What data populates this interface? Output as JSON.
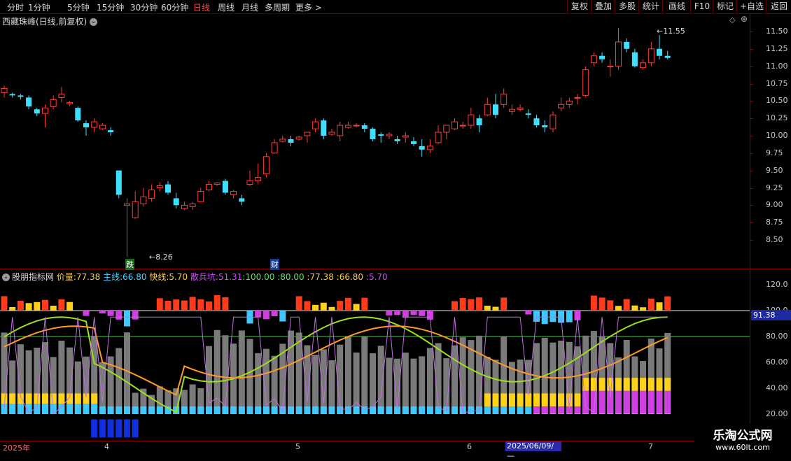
{
  "toolbar": {
    "periods": [
      "分时",
      "1分钟",
      "5分钟",
      "15分钟",
      "30分钟",
      "60分钟",
      "日线",
      "周线",
      "月线",
      "多周期",
      "更多"
    ],
    "active_period": "日线",
    "right_buttons": [
      "复权",
      "叠加",
      "多股",
      "统计",
      "画线",
      "F10",
      "标记",
      "+自选",
      "返回"
    ]
  },
  "main_chart": {
    "title": "西藏珠峰(日线,前复权)",
    "high_label": "11.55",
    "low_label": "8.26",
    "price_ticks": [
      "11.50",
      "11.25",
      "11.00",
      "10.75",
      "10.50",
      "10.25",
      "10.00",
      "9.75",
      "9.50",
      "9.25",
      "9.00",
      "8.75",
      "8.50"
    ],
    "markers": [
      {
        "text": "跌",
        "color": "#1a6b1a"
      },
      {
        "text": "财",
        "color": "#1a3a8a"
      }
    ]
  },
  "indicator": {
    "name": "股朋指标网",
    "items": [
      {
        "label": "价量:",
        "value": "77.38",
        "color": "#ffcc44"
      },
      {
        "label": "主线:",
        "value": "66.80",
        "color": "#49d4ff"
      },
      {
        "label": "快线:",
        "value": "5.70",
        "color": "#ffcc44"
      },
      {
        "label": "散兵坑:",
        "value": "51.31",
        "color": "#d04cff"
      },
      {
        "label": ":",
        "value": "100.00",
        "color": "#66e066"
      },
      {
        "label": ":",
        "value": "80.00",
        "color": "#66e066"
      },
      {
        "label": ":",
        "value": "77.38",
        "color": "#ffcc44"
      },
      {
        "label": ":",
        "value": "66.80",
        "color": "#ffcc44"
      },
      {
        "label": ":",
        "value": "5.70",
        "color": "#d04cff"
      }
    ],
    "ticks": [
      "120.0",
      "100.0",
      "80.00",
      "60.00",
      "40.00",
      "20.00"
    ],
    "current_value": "91.38"
  },
  "dates": {
    "labels": [
      "2025年",
      "4",
      "5",
      "6",
      "7"
    ],
    "highlight": "2025/06/09/—"
  },
  "watermark": {
    "line1": "乐淘公式网",
    "line2": "www.60lt.com"
  },
  "colors": {
    "up": "#ff3b3b",
    "down": "#3fe0ff",
    "grid": "#8a0000",
    "bg": "#000000"
  },
  "chart_data": {
    "type": "candlestick",
    "price_axis": [
      8.5,
      11.5
    ],
    "candles": [
      [
        10.62,
        10.72,
        10.55,
        10.68
      ],
      [
        10.6,
        10.62,
        10.55,
        10.58
      ],
      [
        10.58,
        10.6,
        10.52,
        10.56
      ],
      [
        10.55,
        10.58,
        10.38,
        10.42
      ],
      [
        10.38,
        10.4,
        10.28,
        10.32
      ],
      [
        10.32,
        10.45,
        10.12,
        10.4
      ],
      [
        10.42,
        10.58,
        10.38,
        10.52
      ],
      [
        10.55,
        10.7,
        10.48,
        10.6
      ],
      [
        10.46,
        10.5,
        10.42,
        10.48
      ],
      [
        10.4,
        10.42,
        10.2,
        10.22
      ],
      [
        10.18,
        10.22,
        10.0,
        10.12
      ],
      [
        10.12,
        10.25,
        10.05,
        10.2
      ],
      [
        10.1,
        10.18,
        10.08,
        10.15
      ],
      [
        10.08,
        10.12,
        10.0,
        10.05
      ],
      [
        9.5,
        9.5,
        9.1,
        9.15
      ],
      [
        9.0,
        9.1,
        8.26,
        9.02
      ],
      [
        8.82,
        9.2,
        8.8,
        9.05
      ],
      [
        9.02,
        9.25,
        8.98,
        9.12
      ],
      [
        9.1,
        9.3,
        9.05,
        9.22
      ],
      [
        9.25,
        9.33,
        9.2,
        9.28
      ],
      [
        9.3,
        9.35,
        9.15,
        9.18
      ],
      [
        9.1,
        9.18,
        8.95,
        9.0
      ],
      [
        8.95,
        9.05,
        8.93,
        9.0
      ],
      [
        8.98,
        9.05,
        8.93,
        9.02
      ],
      [
        9.05,
        9.25,
        9.05,
        9.2
      ],
      [
        9.22,
        9.35,
        9.2,
        9.3
      ],
      [
        9.3,
        9.33,
        9.28,
        9.32
      ],
      [
        9.35,
        9.38,
        9.15,
        9.18
      ],
      [
        9.15,
        9.22,
        9.1,
        9.2
      ],
      [
        9.1,
        9.15,
        9.0,
        9.05
      ],
      [
        9.3,
        9.5,
        9.28,
        9.35
      ],
      [
        9.35,
        9.6,
        9.3,
        9.4
      ],
      [
        9.45,
        9.75,
        9.4,
        9.7
      ],
      [
        9.75,
        9.95,
        9.75,
        9.9
      ],
      [
        9.92,
        10.0,
        9.9,
        9.95
      ],
      [
        9.95,
        10.0,
        9.85,
        9.9
      ],
      [
        9.95,
        10.0,
        9.93,
        9.98
      ],
      [
        10.0,
        10.05,
        9.9,
        10.05
      ],
      [
        10.1,
        10.25,
        10.05,
        10.2
      ],
      [
        10.22,
        10.25,
        9.95,
        10.0
      ],
      [
        10.02,
        10.1,
        10.0,
        10.05
      ],
      [
        10.0,
        10.2,
        9.92,
        10.15
      ],
      [
        10.12,
        10.2,
        10.1,
        10.15
      ],
      [
        10.15,
        10.18,
        10.12,
        10.15
      ],
      [
        10.15,
        10.18,
        10.05,
        10.1
      ],
      [
        10.1,
        10.12,
        9.92,
        9.95
      ],
      [
        10.02,
        10.05,
        9.9,
        10.0
      ],
      [
        10.0,
        10.05,
        9.95,
        10.02
      ],
      [
        9.95,
        10.0,
        9.88,
        9.92
      ],
      [
        9.98,
        10.05,
        9.9,
        10.0
      ],
      [
        9.92,
        9.98,
        9.85,
        9.88
      ],
      [
        9.85,
        9.95,
        9.7,
        9.8
      ],
      [
        9.8,
        9.95,
        9.75,
        9.85
      ],
      [
        9.9,
        10.15,
        9.88,
        10.05
      ],
      [
        10.05,
        10.1,
        9.95,
        10.15
      ],
      [
        10.1,
        10.25,
        10.08,
        10.2
      ],
      [
        10.15,
        10.2,
        10.1,
        10.15
      ],
      [
        10.15,
        10.4,
        10.1,
        10.3
      ],
      [
        10.25,
        10.3,
        10.05,
        10.15
      ],
      [
        10.3,
        10.55,
        10.28,
        10.45
      ],
      [
        10.45,
        10.6,
        10.25,
        10.3
      ],
      [
        10.45,
        10.68,
        10.4,
        10.6
      ],
      [
        10.35,
        10.45,
        10.3,
        10.38
      ],
      [
        10.38,
        10.45,
        10.35,
        10.4
      ],
      [
        10.32,
        10.38,
        10.25,
        10.3
      ],
      [
        10.25,
        10.3,
        10.12,
        10.15
      ],
      [
        10.15,
        10.22,
        10.05,
        10.12
      ],
      [
        10.1,
        10.35,
        10.05,
        10.3
      ],
      [
        10.4,
        10.55,
        10.35,
        10.45
      ],
      [
        10.45,
        10.55,
        10.4,
        10.5
      ],
      [
        10.55,
        10.6,
        10.45,
        10.55
      ],
      [
        10.58,
        11.0,
        10.55,
        10.95
      ],
      [
        11.05,
        11.2,
        11.0,
        11.15
      ],
      [
        11.15,
        11.2,
        11.05,
        11.1
      ],
      [
        11.0,
        11.1,
        10.85,
        11.0
      ],
      [
        11.0,
        11.55,
        10.95,
        11.35
      ],
      [
        11.35,
        11.4,
        11.2,
        11.25
      ],
      [
        11.2,
        11.25,
        10.98,
        11.0
      ],
      [
        10.98,
        11.1,
        10.95,
        11.05
      ],
      [
        11.05,
        11.35,
        11.0,
        11.25
      ],
      [
        11.25,
        11.45,
        11.1,
        11.15
      ],
      [
        11.15,
        11.22,
        11.1,
        11.12
      ]
    ]
  }
}
